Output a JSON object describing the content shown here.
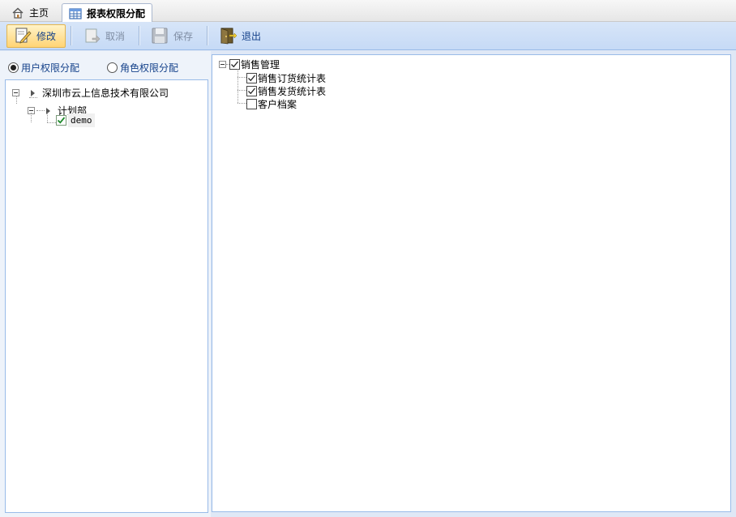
{
  "tabs": [
    {
      "label": "主页",
      "icon": "home-icon"
    },
    {
      "label": "报表权限分配",
      "icon": "table-icon"
    }
  ],
  "toolbar": {
    "edit_label": "修改",
    "cancel_label": "取消",
    "save_label": "保存",
    "exit_label": "退出"
  },
  "mode": {
    "user_label": "用户权限分配",
    "role_label": "角色权限分配",
    "selected": "user"
  },
  "org_tree": {
    "company": "深圳市云上信息技术有限公司",
    "department": "计划部",
    "user": "demo",
    "user_checked": true
  },
  "report_tree": {
    "root": {
      "label": "销售管理",
      "checked": true
    },
    "children": [
      {
        "label": "销售订货统计表",
        "checked": true
      },
      {
        "label": "销售发货统计表",
        "checked": true
      },
      {
        "label": "客户档案",
        "checked": false
      }
    ]
  }
}
